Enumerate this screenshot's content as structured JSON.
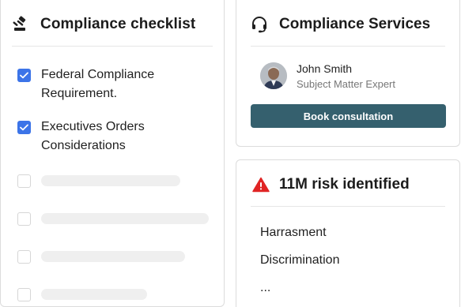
{
  "checklist": {
    "title": "Compliance checklist",
    "icon": "gavel-icon",
    "items": [
      {
        "label": "Federal Compliance Requirement.",
        "checked": true
      },
      {
        "label": "Executives Orders Considerations",
        "checked": true
      }
    ],
    "placeholder_rows": 4
  },
  "services": {
    "title": "Compliance Services",
    "icon": "headset-icon",
    "person": {
      "name": "John Smith",
      "role": "Subject Matter Expert"
    },
    "book_label": "Book consultation",
    "button_color": "#35606e"
  },
  "risk": {
    "title": "11M risk identified",
    "icon": "warning-triangle-icon",
    "icon_color": "#e02424",
    "items": [
      "Harrasment",
      "Discrimination",
      "..."
    ]
  },
  "colors": {
    "checkbox_checked": "#3c74e8",
    "skeleton": "#efefef",
    "border": "#dcdcdc"
  }
}
